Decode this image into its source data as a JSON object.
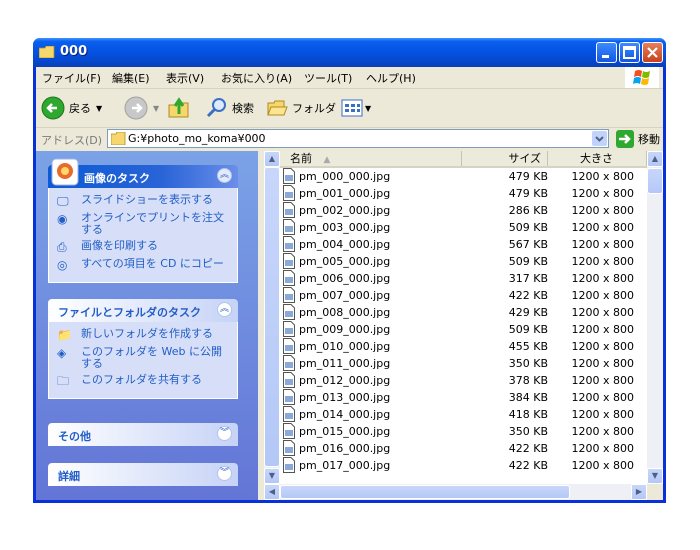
{
  "window": {
    "title": "000"
  },
  "menu": [
    "ファイル(F)",
    "編集(E)",
    "表示(V)",
    "お気に入り(A)",
    "ツール(T)",
    "ヘルプ(H)"
  ],
  "toolbar": {
    "back_label": "戻る",
    "search_label": "検索",
    "folder_label": "フォルダ"
  },
  "address": {
    "label": "アドレス(D)",
    "value": "G:¥photo_mo_koma¥000",
    "go_label": "移動"
  },
  "tasks": {
    "image_title": "画像のタスク",
    "image_items": [
      "スライドショーを表示する",
      "オンラインでプリントを注文する",
      "画像を印刷する",
      "すべての項目を CD にコピー"
    ],
    "folder_title": "ファイルとフォルダのタスク",
    "folder_items": [
      "新しいフォルダを作成する",
      "このフォルダを Web に公開する",
      "このフォルダを共有する"
    ],
    "other_title": "その他",
    "details_title": "詳細"
  },
  "columns": {
    "name": "名前",
    "size": "サイズ",
    "dimensions": "大きさ"
  },
  "files": [
    {
      "name": "pm_000_000.jpg",
      "size": "479 KB",
      "dim": "1200 x 800"
    },
    {
      "name": "pm_001_000.jpg",
      "size": "479 KB",
      "dim": "1200 x 800"
    },
    {
      "name": "pm_002_000.jpg",
      "size": "286 KB",
      "dim": "1200 x 800"
    },
    {
      "name": "pm_003_000.jpg",
      "size": "509 KB",
      "dim": "1200 x 800"
    },
    {
      "name": "pm_004_000.jpg",
      "size": "567 KB",
      "dim": "1200 x 800"
    },
    {
      "name": "pm_005_000.jpg",
      "size": "509 KB",
      "dim": "1200 x 800"
    },
    {
      "name": "pm_006_000.jpg",
      "size": "317 KB",
      "dim": "1200 x 800"
    },
    {
      "name": "pm_007_000.jpg",
      "size": "422 KB",
      "dim": "1200 x 800"
    },
    {
      "name": "pm_008_000.jpg",
      "size": "429 KB",
      "dim": "1200 x 800"
    },
    {
      "name": "pm_009_000.jpg",
      "size": "509 KB",
      "dim": "1200 x 800"
    },
    {
      "name": "pm_010_000.jpg",
      "size": "455 KB",
      "dim": "1200 x 800"
    },
    {
      "name": "pm_011_000.jpg",
      "size": "350 KB",
      "dim": "1200 x 800"
    },
    {
      "name": "pm_012_000.jpg",
      "size": "378 KB",
      "dim": "1200 x 800"
    },
    {
      "name": "pm_013_000.jpg",
      "size": "384 KB",
      "dim": "1200 x 800"
    },
    {
      "name": "pm_014_000.jpg",
      "size": "418 KB",
      "dim": "1200 x 800"
    },
    {
      "name": "pm_015_000.jpg",
      "size": "350 KB",
      "dim": "1200 x 800"
    },
    {
      "name": "pm_016_000.jpg",
      "size": "422 KB",
      "dim": "1200 x 800"
    },
    {
      "name": "pm_017_000.jpg",
      "size": "422 KB",
      "dim": "1200 x 800"
    }
  ],
  "colors": {
    "titlebar": "#0553e3",
    "link": "#215dc6",
    "task_pane": "#7ba2e7"
  }
}
